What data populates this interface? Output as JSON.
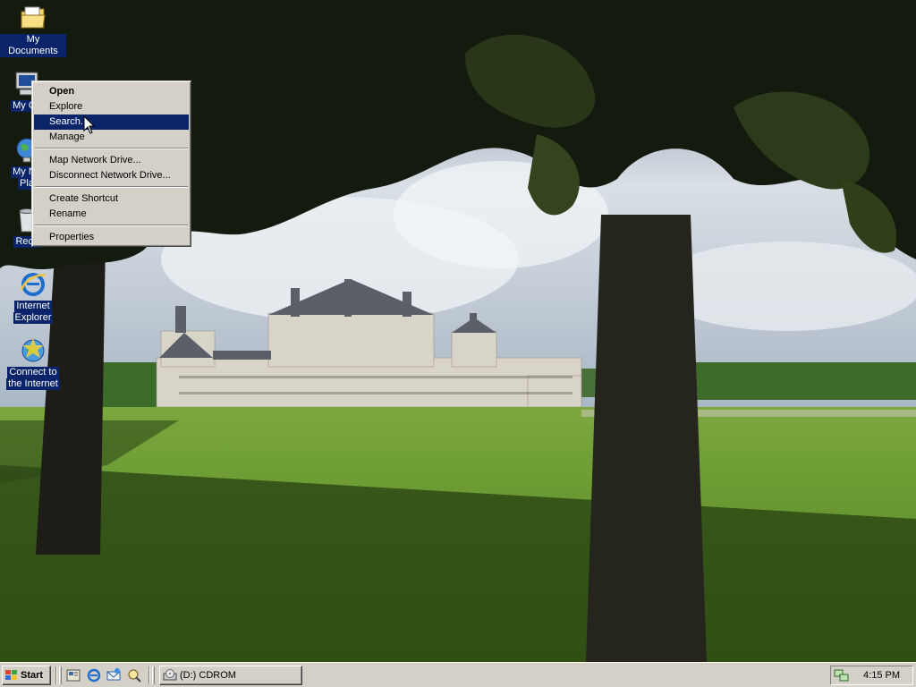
{
  "desktop": {
    "icons": [
      {
        "label_lines": [
          "My Documents"
        ],
        "icon": "folder-documents-icon"
      },
      {
        "label_lines": [
          "My Co"
        ],
        "icon": "my-computer-icon"
      },
      {
        "label_lines": [
          "My Ne",
          "Pla"
        ],
        "icon": "network-places-icon"
      },
      {
        "label_lines": [
          "Recy"
        ],
        "icon": "recycle-bin-icon"
      },
      {
        "label_lines": [
          "Internet",
          "Explorer"
        ],
        "icon": "internet-explorer-icon"
      },
      {
        "label_lines": [
          "Connect to",
          "the Internet"
        ],
        "icon": "connect-internet-icon"
      }
    ]
  },
  "context_menu": {
    "groups": [
      [
        {
          "label": "Open",
          "bold": true
        },
        {
          "label": "Explore"
        },
        {
          "label": "Search...",
          "highlighted": true
        },
        {
          "label": "Manage"
        }
      ],
      [
        {
          "label": "Map Network Drive..."
        },
        {
          "label": "Disconnect Network Drive..."
        }
      ],
      [
        {
          "label": "Create Shortcut"
        },
        {
          "label": "Rename"
        }
      ],
      [
        {
          "label": "Properties"
        }
      ]
    ]
  },
  "taskbar": {
    "start_label": "Start",
    "quick_launch": [
      "show-desktop-icon",
      "internet-explorer-icon",
      "outlook-express-icon",
      "media-player-icon"
    ],
    "task_button_label": "(D:) CDROM",
    "clock": "4:15 PM"
  },
  "colors": {
    "highlight": "#0a246a",
    "face": "#d4d0c8",
    "grass": "#5f8f2e",
    "sky": "#c9d3dc"
  }
}
